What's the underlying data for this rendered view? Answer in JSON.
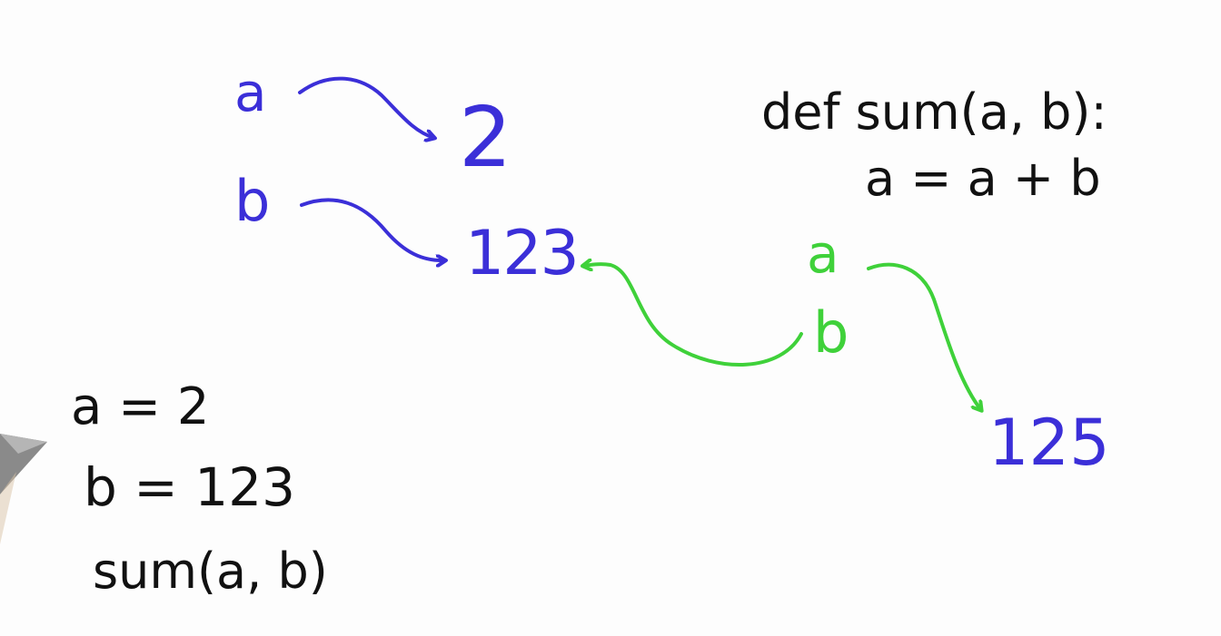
{
  "global_vars": {
    "a_name": "a",
    "b_name": "b",
    "a_value": "2",
    "b_value": "123"
  },
  "function_def": {
    "line1": "def sum(a, b):",
    "line2": "a = a + b"
  },
  "local_vars": {
    "a_name": "a",
    "b_name": "b",
    "result_value": "125"
  },
  "call_code": {
    "line1": "a = 2",
    "line2": "b = 123",
    "line3": "sum(a, b)"
  },
  "colors": {
    "global": "#3b2fd8",
    "local": "#3fd13a",
    "code": "#111111"
  }
}
